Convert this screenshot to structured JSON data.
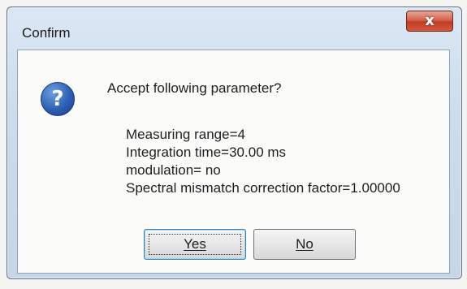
{
  "window": {
    "title": "Confirm",
    "close_symbol": "x"
  },
  "dialog": {
    "icon": "question-icon",
    "prompt": "Accept following parameter?",
    "parameters": [
      "Measuring range=4",
      "Integration time=30.00 ms",
      "modulation= no",
      "Spectral mismatch correction factor=1.00000"
    ]
  },
  "buttons": {
    "yes_label": "Yes",
    "no_label": "No"
  },
  "colors": {
    "close_button": "#c13d25",
    "question_icon": "#2d5fb4",
    "frame": "#c7d6e7"
  }
}
